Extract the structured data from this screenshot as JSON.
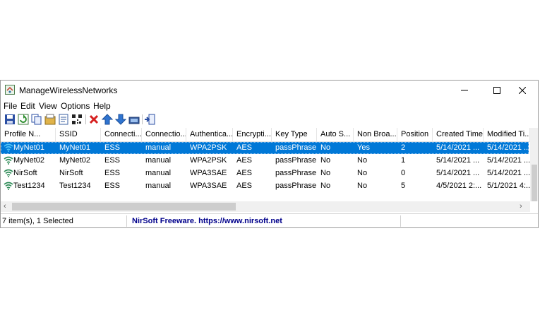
{
  "window": {
    "title": "ManageWirelessNetworks"
  },
  "menu": [
    "File",
    "Edit",
    "View",
    "Options",
    "Help"
  ],
  "toolbar": [
    "save-icon",
    "refresh-icon",
    "copy-icon",
    "properties-icon",
    "html-report-icon",
    "qr-code-icon",
    "delete-icon",
    "move-up-icon",
    "move-down-icon",
    "connect-icon",
    "exit-icon"
  ],
  "columns": [
    "Profile N...",
    "SSID",
    "Connecti...",
    "Connectio...",
    "Authentica...",
    "Encrypti...",
    "Key Type",
    "Auto S...",
    "Non Broa...",
    "Position",
    "Created Time",
    "Modified Ti..."
  ],
  "rows": [
    [
      "MyNet01",
      "MyNet01",
      "ESS",
      "manual",
      "WPA2PSK",
      "AES",
      "passPhrase",
      "No",
      "Yes",
      "2",
      "5/14/2021 ...",
      "5/14/2021 ..."
    ],
    [
      "MyNet02",
      "MyNet02",
      "ESS",
      "manual",
      "WPA2PSK",
      "AES",
      "passPhrase",
      "No",
      "No",
      "1",
      "5/14/2021 ...",
      "5/14/2021 ..."
    ],
    [
      "NirSoft",
      "NirSoft",
      "ESS",
      "manual",
      "WPA3SAE",
      "AES",
      "passPhrase",
      "No",
      "No",
      "0",
      "5/14/2021 ...",
      "5/14/2021 ..."
    ],
    [
      "Test1234",
      "Test1234",
      "ESS",
      "manual",
      "WPA3SAE",
      "AES",
      "passPhrase",
      "No",
      "No",
      "5",
      "4/5/2021 2:...",
      "5/1/2021 4:..."
    ]
  ],
  "selected_row": 0,
  "status": {
    "count": "7 item(s), 1 Selected",
    "link": "NirSoft Freeware. https://www.nirsoft.net"
  },
  "colors": {
    "selection": "#0078d7",
    "link": "#00008b",
    "wifi": "#2e8b57"
  }
}
